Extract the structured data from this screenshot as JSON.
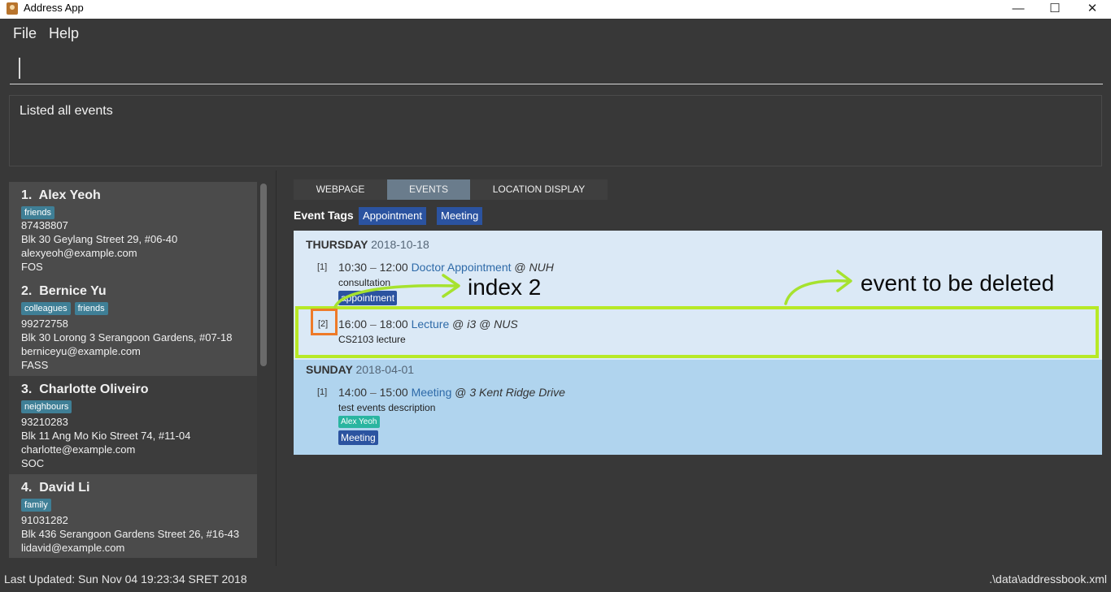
{
  "window": {
    "title": "Address App",
    "minimize_glyph": "—",
    "maximize_glyph": "☐",
    "close_glyph": "✕"
  },
  "menu": {
    "file": "File",
    "help": "Help"
  },
  "command_box": {
    "value": ""
  },
  "result_display": "Listed all events",
  "persons": [
    {
      "index": "1.",
      "name": "Alex Yeoh",
      "tags": [
        "friends"
      ],
      "phone": "87438807",
      "address": "Blk 30 Geylang Street 29, #06-40",
      "email": "alexyeoh@example.com",
      "faculty": "FOS"
    },
    {
      "index": "2.",
      "name": "Bernice Yu",
      "tags": [
        "colleagues",
        "friends"
      ],
      "phone": "99272758",
      "address": "Blk 30 Lorong 3 Serangoon Gardens, #07-18",
      "email": "berniceyu@example.com",
      "faculty": "FASS"
    },
    {
      "index": "3.",
      "name": "Charlotte Oliveiro",
      "tags": [
        "neighbours"
      ],
      "phone": "93210283",
      "address": "Blk 11 Ang Mo Kio Street 74, #11-04",
      "email": "charlotte@example.com",
      "faculty": "SOC"
    },
    {
      "index": "4.",
      "name": "David Li",
      "tags": [
        "family"
      ],
      "phone": "91031282",
      "address": "Blk 436 Serangoon Gardens Street 26, #16-43",
      "email": "lidavid@example.com",
      "faculty": ""
    }
  ],
  "tabs": [
    {
      "label": "WEBPAGE"
    },
    {
      "label": "EVENTS"
    },
    {
      "label": "LOCATION DISPLAY"
    }
  ],
  "event_tags": {
    "label": "Event Tags",
    "tags": [
      "Appointment",
      "Meeting"
    ]
  },
  "days": [
    {
      "weekday": "THURSDAY",
      "date": "2018-10-18",
      "events": [
        {
          "index": "[1]",
          "start": "10:30",
          "dash": "–",
          "end": "12:00",
          "name": "Doctor Appointment",
          "at": "@",
          "location": "NUH",
          "description": "consultation",
          "tag": "appointment"
        },
        {
          "index": "[2]",
          "start": "16:00",
          "dash": "–",
          "end": "18:00",
          "name": "Lecture",
          "at": "@",
          "location": "i3 @ NUS",
          "description": "CS2103 lecture"
        }
      ]
    },
    {
      "weekday": "SUNDAY",
      "date": "2018-04-01",
      "events": [
        {
          "index": "[1]",
          "start": "14:00",
          "dash": "–",
          "end": "15:00",
          "name": "Meeting",
          "at": "@",
          "location": "3 Kent Ridge Drive",
          "description": "test events description",
          "person": "Alex Yeoh",
          "tag": "Meeting"
        }
      ]
    }
  ],
  "annotations": {
    "index": "index 2",
    "event": "event to be deleted"
  },
  "status": {
    "last_updated": "Last Updated: Sun Nov 04 19:23:34 SRET 2018",
    "file": ".\\data\\addressbook.xml"
  },
  "colors": {
    "highlight": "#b7e926",
    "index_marker": "#ee7a28",
    "tag": "#3f7f96",
    "event_tag": "#2b53a0"
  }
}
